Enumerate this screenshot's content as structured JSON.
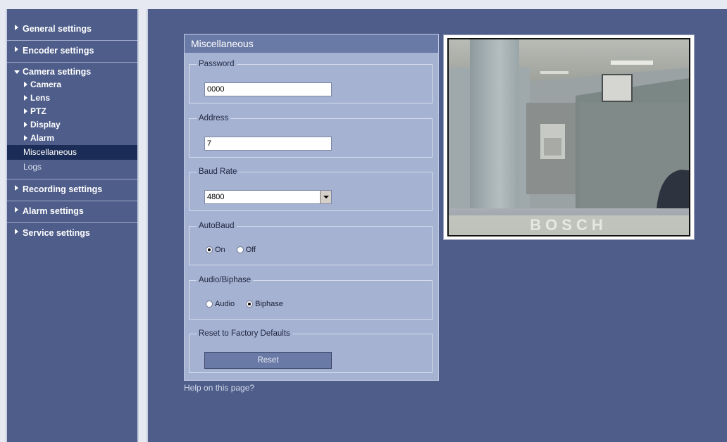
{
  "sidebar": {
    "groups": [
      {
        "label": "General settings"
      },
      {
        "label": "Encoder settings"
      },
      {
        "label": "Camera settings",
        "subitems": [
          "Camera",
          "Lens",
          "PTZ",
          "Display",
          "Alarm"
        ],
        "plain": [
          "Miscellaneous",
          "Logs"
        ],
        "active": "Miscellaneous"
      },
      {
        "label": "Recording settings"
      },
      {
        "label": "Alarm settings"
      },
      {
        "label": "Service settings"
      }
    ]
  },
  "panel": {
    "title": "Miscellaneous",
    "password": {
      "legend": "Password",
      "value": "0000"
    },
    "address": {
      "legend": "Address",
      "value": "7"
    },
    "baud": {
      "legend": "Baud Rate",
      "value": "4800"
    },
    "autobaud": {
      "legend": "AutoBaud",
      "on": "On",
      "off": "Off",
      "selected": "On"
    },
    "audio_biphase": {
      "legend": "Audio/Biphase",
      "audio": "Audio",
      "biphase": "Biphase",
      "selected": "Biphase"
    },
    "reset": {
      "legend": "Reset to Factory Defaults",
      "button": "Reset"
    }
  },
  "help": "Help on this page?",
  "video": {
    "watermark": "BOSCH"
  },
  "colors": {
    "sidebar_bg": "#4e5d8a",
    "panel_bg": "#a6b2d2",
    "panel_title": "#6a7aa6",
    "active_item": "#1b2c57"
  }
}
